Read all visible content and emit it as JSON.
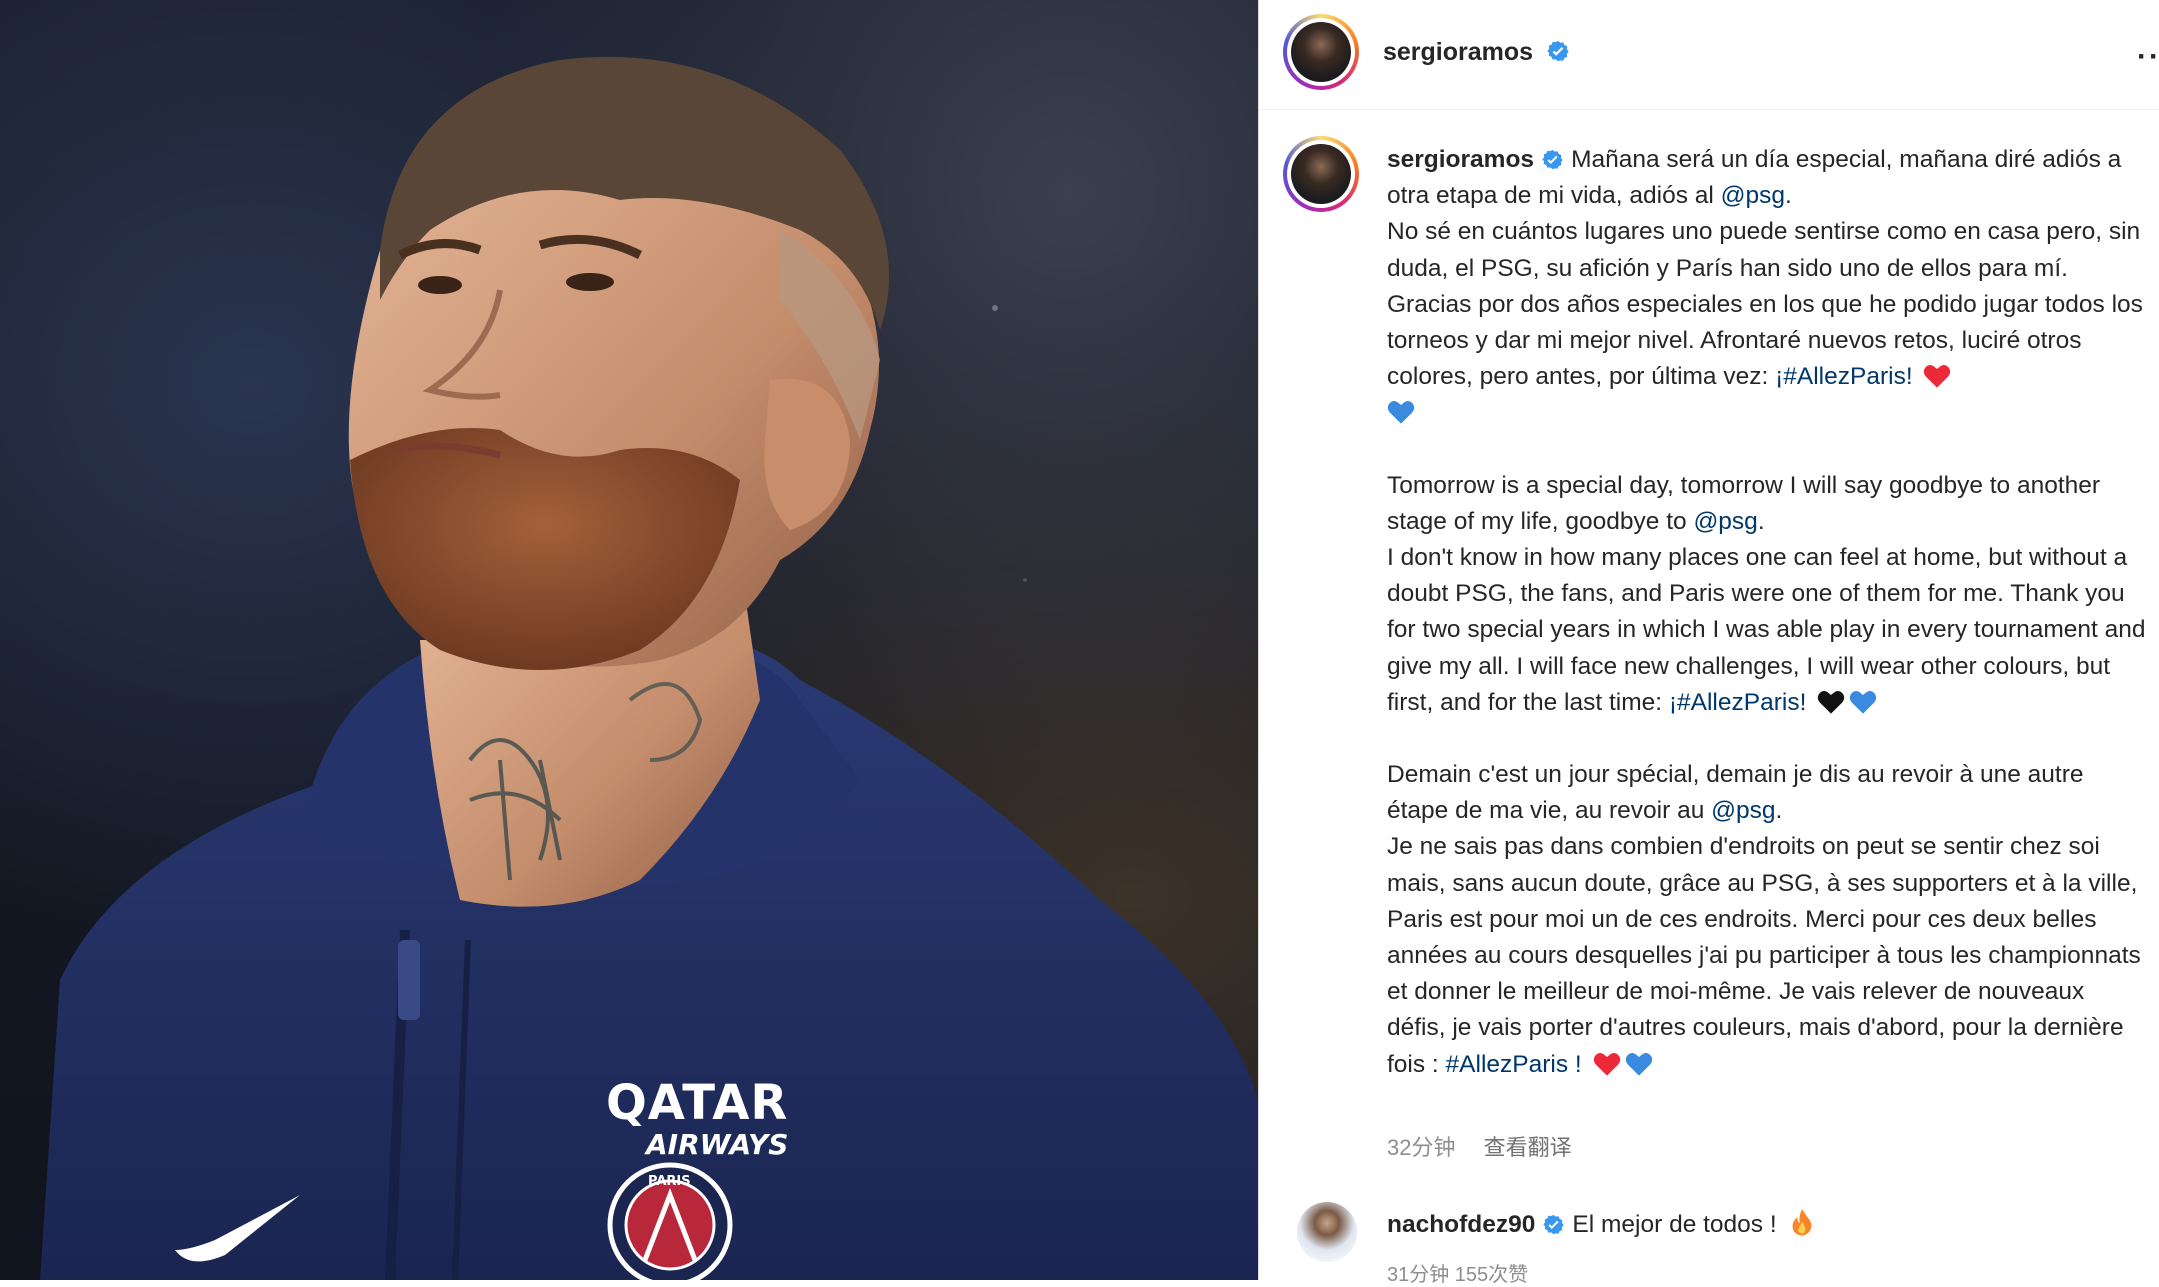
{
  "post": {
    "username": "sergioramos",
    "more_label": "···"
  },
  "caption": {
    "username": "sergioramos",
    "spanish_1": "Mañana será un día especial, mañana diré adiós a otra etapa de mi vida, adiós al ",
    "spanish_1_link": "@psg",
    "spanish_1_end": ".",
    "spanish_2": "No sé en cuántos lugares uno puede sentirse como en casa pero, sin duda, el PSG, su afición y París han sido uno de ellos para mí. Gracias por dos años especiales en los que he podido jugar todos los torneos y dar mi mejor nivel. Afrontaré nuevos retos, luciré otros colores, pero antes, por última vez: ",
    "spanish_2_link": "¡#AllezParis!",
    "english_1": "Tomorrow is a special day, tomorrow I will say goodbye to another stage of my life, goodbye to ",
    "english_1_link": "@psg",
    "english_1_end": ".",
    "english_2": "I don't know in how many places one can feel at home, but without a doubt PSG, the fans, and Paris were one of them for me. Thank you for two special years in which I was able play in every tournament and give my all. I will face new challenges, I will wear other colours, but first, and for the last time: ",
    "english_2_link": "¡#AllezParis!",
    "french_1": "Demain c'est un jour spécial, demain je dis au revoir à une autre étape de ma vie, au revoir au ",
    "french_1_link": "@psg",
    "french_1_end": ".",
    "french_2": "Je ne sais pas dans combien d'endroits on peut se sentir chez soi mais, sans aucun doute, grâce au PSG, à ses supporters et à la ville, Paris est pour moi un de ces endroits. Merci pour ces deux belles années au cours desquelles j'ai pu participer à tous les championnats et donner le meilleur de moi-même. Je vais relever de nouveaux défis, je vais porter d'autres couleurs, mais d'abord, pour la dernière fois : ",
    "french_2_link": "#AllezParis !"
  },
  "meta": {
    "time": "32分钟",
    "translate": "查看翻译"
  },
  "comment": {
    "username": "nachofdez90",
    "text": "El mejor de todos !",
    "meta": "31分钟    155次赞"
  },
  "photo": {
    "sponsor_line1": "QATAR",
    "sponsor_line2": "AIRWAYS",
    "crest_text": "PARIS"
  },
  "colors": {
    "link": "#00376b",
    "verified": "#3897f0",
    "heart_red": "#ed2939",
    "heart_blue": "#3a8be0",
    "heart_black": "#111111",
    "jacket": "#1f2d5c"
  },
  "icons": [
    "verified-badge-icon",
    "red-heart-icon",
    "blue-heart-icon",
    "black-heart-icon",
    "fire-icon",
    "more-options-icon"
  ]
}
